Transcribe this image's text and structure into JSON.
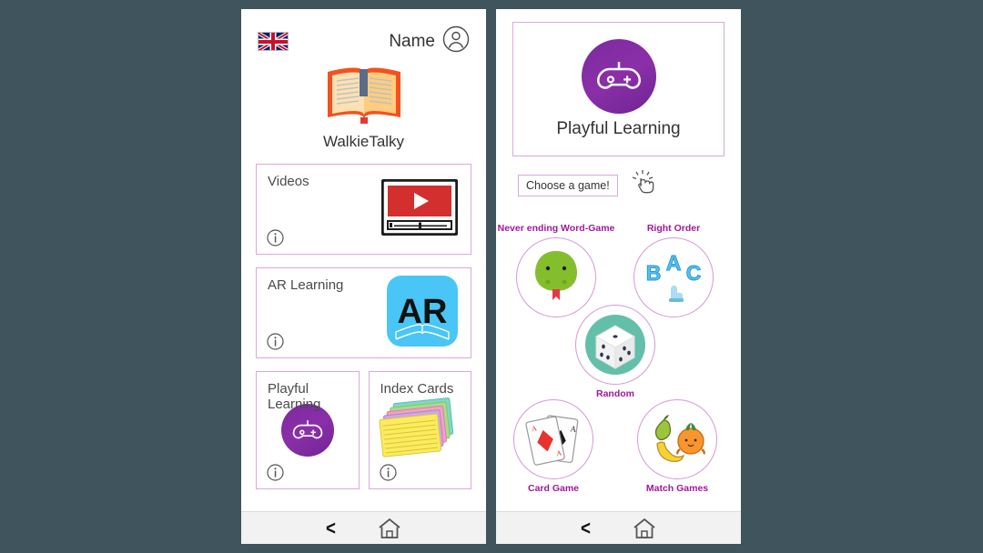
{
  "theme": {
    "background": "#3f545c",
    "card_border": "#dba8db",
    "game_label_color": "#a0189b",
    "gamepad_purple": "#7b2a9e",
    "navbar_bg": "#f2f2f2"
  },
  "left_phone": {
    "header": {
      "flag": "uk-flag-icon",
      "name_label": "Name",
      "avatar_icon": "user-avatar-icon"
    },
    "brand": {
      "logo_icon": "open-book-icon",
      "title": "WalkieTalky"
    },
    "cards": [
      {
        "label": "Videos",
        "icon": "video-player-icon",
        "info": "i"
      },
      {
        "label": "AR Learning",
        "icon": "ar-app-icon",
        "info": "i"
      }
    ],
    "half_cards": [
      {
        "label": "Playful Learning",
        "icon": "gamepad-icon",
        "info": "i"
      },
      {
        "label": "Index Cards",
        "icon": "index-cards-icon",
        "info": "i"
      }
    ],
    "navbar": {
      "back": "<",
      "home": "home-icon"
    }
  },
  "right_phone": {
    "header": {
      "icon": "gamepad-icon",
      "title": "Playful Learning"
    },
    "choose": {
      "button_label": "Choose a game!",
      "cursor_icon": "tap-hand-icon"
    },
    "games": [
      {
        "label": "Never ending Word-Game",
        "icon": "snake-icon",
        "label_position": "top"
      },
      {
        "label": "Right Order",
        "icon": "abc-letters-icon",
        "label_position": "top"
      },
      {
        "label": "Random",
        "icon": "dice-icon",
        "label_position": "bottom"
      },
      {
        "label": "Card Game",
        "icon": "playing-cards-icon",
        "label_position": "bottom"
      },
      {
        "label": "Match Games",
        "icon": "fruits-icon",
        "label_position": "bottom"
      }
    ],
    "navbar": {
      "back": "<",
      "home": "home-icon"
    }
  }
}
